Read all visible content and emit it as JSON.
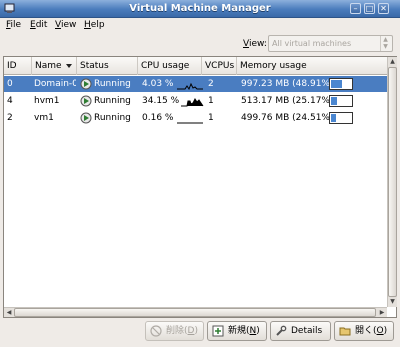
{
  "window": {
    "title": "Virtual Machine Manager"
  },
  "menu": {
    "file": {
      "mnemonic": "F",
      "rest": "ile"
    },
    "edit": {
      "mnemonic": "E",
      "rest": "dit"
    },
    "view": {
      "mnemonic": "V",
      "rest": "iew"
    },
    "help": {
      "mnemonic": "H",
      "rest": "elp"
    }
  },
  "filter": {
    "label_mnemonic": "V",
    "label_rest": "iew:",
    "selected": "All virtual machines"
  },
  "columns": [
    "ID",
    "Name",
    "Status",
    "CPU usage",
    "VCPUs",
    "Memory usage"
  ],
  "vms": [
    {
      "id": "0",
      "name": "Domain-0",
      "status": "Running",
      "cpu": "4.03 %",
      "vcpus": "2",
      "memory": "997.23 MB (48.91%)",
      "memory_fraction": 0.4891,
      "selected": true
    },
    {
      "id": "4",
      "name": "hvm1",
      "status": "Running",
      "cpu": "34.15 %",
      "vcpus": "1",
      "memory": "513.17 MB (25.17%)",
      "memory_fraction": 0.2517,
      "selected": false
    },
    {
      "id": "2",
      "name": "vm1",
      "status": "Running",
      "cpu": "0.16 %",
      "vcpus": "1",
      "memory": "499.76 MB (24.51%)",
      "memory_fraction": 0.2451,
      "selected": false
    }
  ],
  "buttons": {
    "delete": {
      "label": "削除(",
      "mnemonic": "D",
      "close": ")"
    },
    "new": {
      "label": "新規(",
      "mnemonic": "N",
      "close": ")"
    },
    "details": {
      "label": "Details"
    },
    "open": {
      "label": "開く(",
      "mnemonic": "O",
      "close": ")"
    }
  },
  "colors": {
    "selection": "#4a7dc1",
    "titlebar": "#4a7cbc",
    "memory_fill": "#4a86d0"
  }
}
